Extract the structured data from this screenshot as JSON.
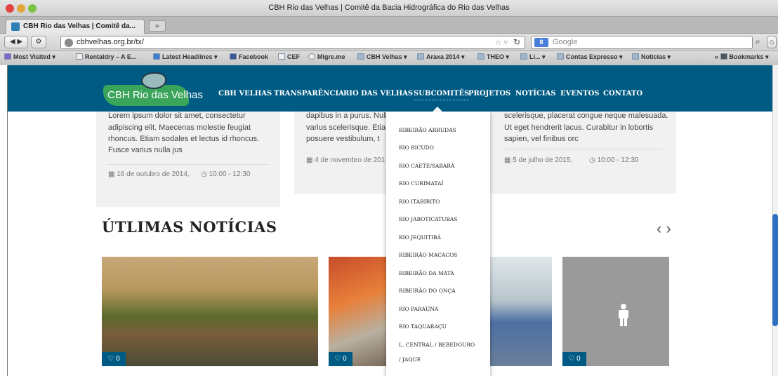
{
  "window": {
    "title": "CBH Rio das Velhas | Comitê da Bacia Hidrográfica do Rio das Velhas"
  },
  "tab": {
    "label": "CBH Rio das Velhas | Comitê da...",
    "new_tab": "+"
  },
  "nav": {
    "url": "cbhvelhas.org.br/tx/",
    "search_placeholder": "Google",
    "search_logo": "8"
  },
  "bookmarks": [
    "Most Visited ▾",
    "Rentaldry – A E...",
    "Latest Headlines ▾",
    "Facebook",
    "CEF",
    "Migre.me",
    "CBH Velhas ▾",
    "Araxa 2014 ▾",
    "THEO ▾",
    "Li... ▾",
    "Contas Expresso ▾",
    "Noticias ▾"
  ],
  "bookmarks_menu": "Bookmarks ▾",
  "site": {
    "logo": "CBH Rio das Velhas",
    "menu": [
      "CBH VELHAS",
      "TRANSPARÊNCIA",
      "RIO DAS VELHAS",
      "SUBCOMITÊS",
      "PROJETOS",
      "NOTÍCIAS",
      "EVENTOS",
      "CONTATO"
    ],
    "submenu": [
      "RIBEIRÃO ARRUDAS",
      "RIO BICUDO",
      "RIO CAETÉ/SABARÁ",
      "RIO CURIMATAÍ",
      "RIO ITABIRITO",
      "RIO JABOTICATUBAS",
      "RIO JEQUITIBÁ",
      "RIBEIRÃO MACACOS",
      "RIBEIRÃO DA MATA",
      "RIBEIRÃO DO ONÇA",
      "RIO PARAÚNA",
      "RIO TAQUARAÇU",
      "L. CENTRAL / BEBEDOURO",
      "/ JAQUE"
    ]
  },
  "events": [
    {
      "l1": "Lorem ipsum dolor sit amet, consectetur",
      "l2": "adipiscing elit. Maecenas molestie feugiat",
      "l3": "rhoncus. Etiam sodales et lectus id rhoncus.",
      "l4": "Fusce varius nulla jus",
      "date": "16 de outubro de 2014,",
      "time": "10:00 - 12:30"
    },
    {
      "l1": "dapibus in a purus. Nulla",
      "l2": "varius scelerisque. Etiam",
      "l3": "posuere vestibulum, t",
      "date": "4 de novembro de 201"
    },
    {
      "l1": "scelerisque, placerat congue neque malesuada.",
      "l2": "Ut eget hendrerit lacus. Curabitur in lobortis",
      "l3": "sapien, vel finibus orc",
      "date": "5 de julho de 2015,",
      "time": "10:00 - 12:30"
    }
  ],
  "news": {
    "heading": "ÚTLIMAS NOTÍCIAS",
    "arrows": "‹ ›",
    "likes": [
      "♡ 0",
      "♡ 0",
      "♡ 0"
    ]
  },
  "colors": {
    "header": "#005b84",
    "logo_green": "#3aa55a"
  }
}
